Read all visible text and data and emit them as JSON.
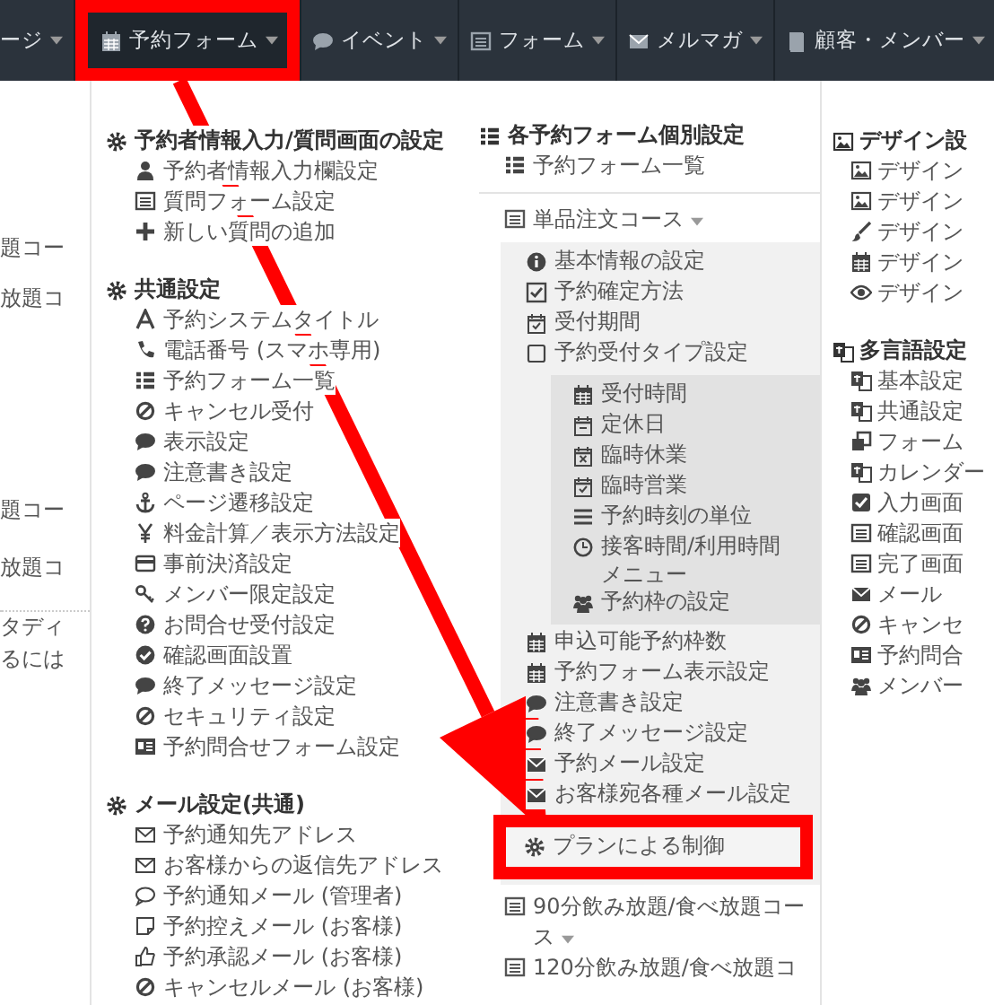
{
  "nav": [
    {
      "label": "ージ",
      "selected": false,
      "highlighted": false
    },
    {
      "label": "予約フォーム",
      "selected": true,
      "highlighted": true
    },
    {
      "label": "イベント",
      "selected": false,
      "highlighted": false
    },
    {
      "label": "フォーム",
      "selected": false,
      "highlighted": false
    },
    {
      "label": "メルマガ",
      "selected": false,
      "highlighted": false
    },
    {
      "label": "顧客・メンバー",
      "selected": false,
      "highlighted": false
    }
  ],
  "left_fragments": [
    "題コー",
    "放題コ",
    "題コー",
    "放題コ",
    "タディ",
    "るには"
  ],
  "settings_column": {
    "sections": [
      {
        "title": "予約者情報入力/質問画面の設定",
        "items": [
          "予約者情報入力欄設定",
          "質問フォーム設定",
          "新しい質問の追加"
        ]
      },
      {
        "title": "共通設定",
        "items": [
          "予約システムタイトル",
          "電話番号 (スマホ専用)",
          "予約フォーム一覧",
          "キャンセル受付",
          "表示設定",
          "注意書き設定",
          "ページ遷移設定",
          "料金計算／表示方法設定",
          "事前決済設定",
          "メンバー限定設定",
          "お問合せ受付設定",
          "確認画面設置",
          "終了メッセージ設定",
          "セキュリティ設定",
          "予約問合せフォーム設定"
        ]
      },
      {
        "title": "メール設定(共通)",
        "items": [
          "予約通知先アドレス",
          "お客様からの返信先アドレス",
          "予約通知メール (管理者)",
          "予約控えメール (お客様)",
          "予約承認メール (お客様)",
          "キャンセルメール (お客様)"
        ]
      }
    ]
  },
  "form_column": {
    "title": "各予約フォーム個別設定",
    "list_link": "予約フォーム一覧",
    "courses": [
      {
        "label": "単品注文コース",
        "has_menu": true,
        "items": [
          {
            "kind": "link",
            "label": "基本情報の設定",
            "highlighted": false
          },
          {
            "kind": "link",
            "label": "予約確定方法",
            "highlighted": false
          },
          {
            "kind": "link",
            "label": "受付期間",
            "highlighted": false
          },
          {
            "kind": "group",
            "label": "予約受付タイプ設定",
            "children": [
              "受付時間",
              "定休日",
              "臨時休業",
              "臨時営業",
              "予約時刻の単位",
              "接客時間/利用時間メニュー",
              "予約枠の設定"
            ]
          },
          {
            "kind": "link",
            "label": "申込可能予約枠数",
            "highlighted": false
          },
          {
            "kind": "link",
            "label": "予約フォーム表示設定",
            "highlighted": false
          },
          {
            "kind": "link",
            "label": "注意書き設定",
            "highlighted": false
          },
          {
            "kind": "link",
            "label": "終了メッセージ設定",
            "highlighted": false
          },
          {
            "kind": "link",
            "label": "予約メール設定",
            "highlighted": false
          },
          {
            "kind": "link",
            "label": "お客様宛各種メール設定",
            "highlighted": false
          },
          {
            "kind": "link",
            "label": "プランによる制御",
            "highlighted": true
          }
        ]
      },
      {
        "label": "90分飲み放題/食べ放題コース",
        "has_menu": true
      },
      {
        "label": "120分飲み放題/食べ放題コ",
        "has_menu": false
      }
    ]
  },
  "right_column": {
    "sections": [
      {
        "title": "デザイン設",
        "items": [
          "デザイン",
          "デザイン",
          "デザイン",
          "デザイン",
          "デザイン"
        ]
      },
      {
        "title": "多言語設定",
        "items": [
          "基本設定",
          "共通設定",
          "フォーム",
          "カレンダー",
          "入力画面",
          "確認画面",
          "完了画面",
          "メール",
          "キャンセ",
          "予約問合",
          "メンバー"
        ]
      }
    ]
  }
}
